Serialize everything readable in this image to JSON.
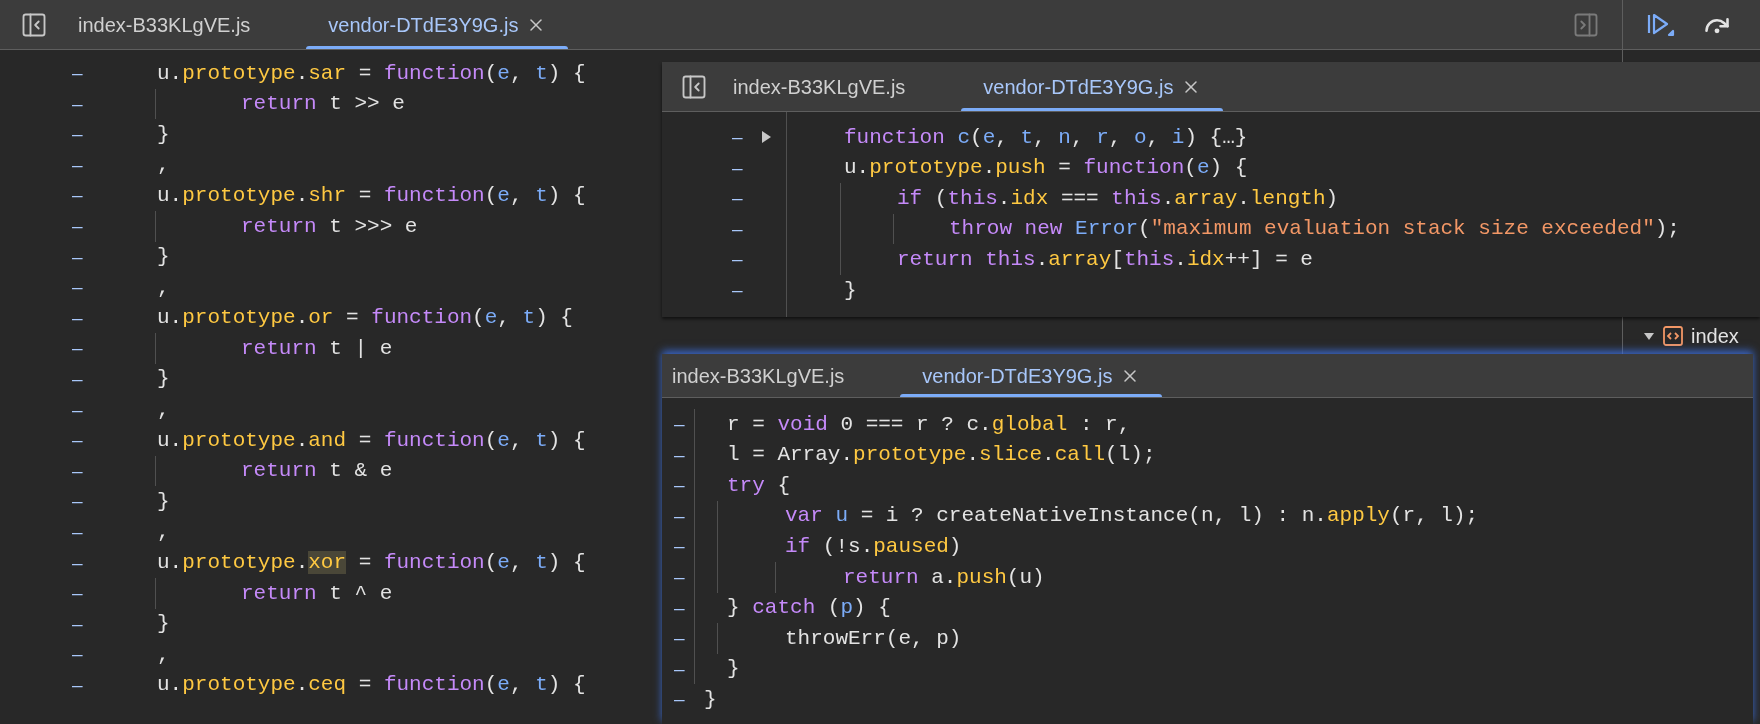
{
  "editor": {
    "tabs": [
      {
        "label": "index-B33KLgVE.js",
        "selected": false
      },
      {
        "label": "vendor-DTdE3Y9G.js",
        "selected": true
      }
    ],
    "lines": [
      {
        "mark": "–",
        "tokens": [
          {
            "kind": "plain",
            "text": "u."
          },
          {
            "kind": "prop",
            "text": "prototype"
          },
          {
            "kind": "plain",
            "text": "."
          },
          {
            "kind": "prop",
            "text": "sar"
          },
          {
            "kind": "plain",
            "text": " = "
          },
          {
            "kind": "kw",
            "text": "function"
          },
          {
            "kind": "plain",
            "text": "("
          },
          {
            "kind": "param",
            "text": "e"
          },
          {
            "kind": "plain",
            "text": ", "
          },
          {
            "kind": "param",
            "text": "t"
          },
          {
            "kind": "plain",
            "text": ") {"
          }
        ],
        "children": [
          {
            "mark": "–",
            "tokens": [
              {
                "kind": "kw",
                "text": "return"
              },
              {
                "kind": "plain",
                "text": " t >> e"
              }
            ]
          }
        ]
      },
      {
        "mark": "–",
        "tokens": [
          {
            "kind": "plain",
            "text": "}"
          }
        ]
      },
      {
        "mark": "–",
        "tokens": [
          {
            "kind": "plain",
            "text": ","
          }
        ]
      },
      {
        "mark": "–",
        "tokens": [
          {
            "kind": "plain",
            "text": "u."
          },
          {
            "kind": "prop",
            "text": "prototype"
          },
          {
            "kind": "plain",
            "text": "."
          },
          {
            "kind": "prop",
            "text": "shr"
          },
          {
            "kind": "plain",
            "text": " = "
          },
          {
            "kind": "kw",
            "text": "function"
          },
          {
            "kind": "plain",
            "text": "("
          },
          {
            "kind": "param",
            "text": "e"
          },
          {
            "kind": "plain",
            "text": ", "
          },
          {
            "kind": "param",
            "text": "t"
          },
          {
            "kind": "plain",
            "text": ") {"
          }
        ],
        "children": [
          {
            "mark": "–",
            "tokens": [
              {
                "kind": "kw",
                "text": "return"
              },
              {
                "kind": "plain",
                "text": " t >>> e"
              }
            ]
          }
        ]
      },
      {
        "mark": "–",
        "tokens": [
          {
            "kind": "plain",
            "text": "}"
          }
        ]
      },
      {
        "mark": "–",
        "tokens": [
          {
            "kind": "plain",
            "text": ","
          }
        ]
      },
      {
        "mark": "–",
        "tokens": [
          {
            "kind": "plain",
            "text": "u."
          },
          {
            "kind": "prop",
            "text": "prototype"
          },
          {
            "kind": "plain",
            "text": "."
          },
          {
            "kind": "prop",
            "text": "or"
          },
          {
            "kind": "plain",
            "text": " = "
          },
          {
            "kind": "kw",
            "text": "function"
          },
          {
            "kind": "plain",
            "text": "("
          },
          {
            "kind": "param",
            "text": "e"
          },
          {
            "kind": "plain",
            "text": ", "
          },
          {
            "kind": "param",
            "text": "t"
          },
          {
            "kind": "plain",
            "text": ") {"
          }
        ],
        "children": [
          {
            "mark": "–",
            "tokens": [
              {
                "kind": "kw",
                "text": "return"
              },
              {
                "kind": "plain",
                "text": " t | e"
              }
            ]
          }
        ]
      },
      {
        "mark": "–",
        "tokens": [
          {
            "kind": "plain",
            "text": "}"
          }
        ]
      },
      {
        "mark": "–",
        "tokens": [
          {
            "kind": "plain",
            "text": ","
          }
        ]
      },
      {
        "mark": "–",
        "tokens": [
          {
            "kind": "plain",
            "text": "u."
          },
          {
            "kind": "prop",
            "text": "prototype"
          },
          {
            "kind": "plain",
            "text": "."
          },
          {
            "kind": "prop",
            "text": "and"
          },
          {
            "kind": "plain",
            "text": " = "
          },
          {
            "kind": "kw",
            "text": "function"
          },
          {
            "kind": "plain",
            "text": "("
          },
          {
            "kind": "param",
            "text": "e"
          },
          {
            "kind": "plain",
            "text": ", "
          },
          {
            "kind": "param",
            "text": "t"
          },
          {
            "kind": "plain",
            "text": ") {"
          }
        ],
        "children": [
          {
            "mark": "–",
            "tokens": [
              {
                "kind": "kw",
                "text": "return"
              },
              {
                "kind": "plain",
                "text": " t & e"
              }
            ]
          }
        ]
      },
      {
        "mark": "–",
        "tokens": [
          {
            "kind": "plain",
            "text": "}"
          }
        ]
      },
      {
        "mark": "–",
        "tokens": [
          {
            "kind": "plain",
            "text": ","
          }
        ]
      },
      {
        "mark": "–",
        "tokens": [
          {
            "kind": "plain",
            "text": "u."
          },
          {
            "kind": "prop",
            "text": "prototype"
          },
          {
            "kind": "plain",
            "text": "."
          },
          {
            "kind": "match",
            "text": "xor"
          },
          {
            "kind": "plain",
            "text": " = "
          },
          {
            "kind": "kw",
            "text": "function"
          },
          {
            "kind": "plain",
            "text": "("
          },
          {
            "kind": "param",
            "text": "e"
          },
          {
            "kind": "plain",
            "text": ", "
          },
          {
            "kind": "param",
            "text": "t"
          },
          {
            "kind": "plain",
            "text": ") {"
          }
        ],
        "children": [
          {
            "mark": "–",
            "tokens": [
              {
                "kind": "kw",
                "text": "return"
              },
              {
                "kind": "plain",
                "text": " t ^ e"
              }
            ]
          }
        ]
      },
      {
        "mark": "–",
        "tokens": [
          {
            "kind": "plain",
            "text": "}"
          }
        ]
      },
      {
        "mark": "–",
        "tokens": [
          {
            "kind": "plain",
            "text": ","
          }
        ]
      },
      {
        "mark": "–",
        "tokens": [
          {
            "kind": "plain",
            "text": "u."
          },
          {
            "kind": "prop",
            "text": "prototype"
          },
          {
            "kind": "plain",
            "text": "."
          },
          {
            "kind": "prop",
            "text": "ceq"
          },
          {
            "kind": "plain",
            "text": " = "
          },
          {
            "kind": "kw",
            "text": "function"
          },
          {
            "kind": "plain",
            "text": "("
          },
          {
            "kind": "param",
            "text": "e"
          },
          {
            "kind": "plain",
            "text": ", "
          },
          {
            "kind": "param",
            "text": "t"
          },
          {
            "kind": "plain",
            "text": ") {"
          }
        ]
      }
    ]
  },
  "overlays": [
    {
      "tabs": [
        {
          "label": "index-B33KLgVE.js",
          "selected": false
        },
        {
          "label": "vendor-DTdE3Y9G.js",
          "selected": true
        }
      ],
      "lines": [
        {
          "mark": "–",
          "expanded": false,
          "tokens": [
            {
              "kind": "kw",
              "text": "function"
            },
            {
              "kind": "param",
              "text": " c"
            },
            {
              "kind": "plain",
              "text": "("
            },
            {
              "kind": "param",
              "text": "e"
            },
            {
              "kind": "plain",
              "text": ", "
            },
            {
              "kind": "param",
              "text": "t"
            },
            {
              "kind": "plain",
              "text": ", "
            },
            {
              "kind": "param",
              "text": "n"
            },
            {
              "kind": "plain",
              "text": ", "
            },
            {
              "kind": "param",
              "text": "r"
            },
            {
              "kind": "plain",
              "text": ", "
            },
            {
              "kind": "param",
              "text": "o"
            },
            {
              "kind": "plain",
              "text": ", "
            },
            {
              "kind": "param",
              "text": "i"
            },
            {
              "kind": "plain",
              "text": ") {…}"
            }
          ]
        },
        {
          "mark": "–",
          "tokens": [
            {
              "kind": "plain",
              "text": "u."
            },
            {
              "kind": "prop",
              "text": "prototype"
            },
            {
              "kind": "plain",
              "text": "."
            },
            {
              "kind": "prop",
              "text": "push"
            },
            {
              "kind": "plain",
              "text": " = "
            },
            {
              "kind": "kw",
              "text": "function"
            },
            {
              "kind": "plain",
              "text": "("
            },
            {
              "kind": "param",
              "text": "e"
            },
            {
              "kind": "plain",
              "text": ") {"
            }
          ],
          "children": [
            {
              "mark": "–",
              "tokens": [
                {
                  "kind": "kw",
                  "text": "if"
                },
                {
                  "kind": "plain",
                  "text": " ("
                },
                {
                  "kind": "kw",
                  "text": "this"
                },
                {
                  "kind": "plain",
                  "text": "."
                },
                {
                  "kind": "prop",
                  "text": "idx"
                },
                {
                  "kind": "plain",
                  "text": " === "
                },
                {
                  "kind": "kw",
                  "text": "this"
                },
                {
                  "kind": "plain",
                  "text": "."
                },
                {
                  "kind": "prop",
                  "text": "array"
                },
                {
                  "kind": "plain",
                  "text": "."
                },
                {
                  "kind": "prop",
                  "text": "length"
                },
                {
                  "kind": "plain",
                  "text": ")"
                }
              ],
              "children": [
                {
                  "mark": "–",
                  "tokens": [
                    {
                      "kind": "kw",
                      "text": "throw"
                    },
                    {
                      "kind": "kw",
                      "text": " new"
                    },
                    {
                      "kind": "param",
                      "text": " Error"
                    },
                    {
                      "kind": "plain",
                      "text": "("
                    },
                    {
                      "kind": "str",
                      "text": "\"maximum evaluation stack size exceeded\""
                    },
                    {
                      "kind": "plain",
                      "text": ");"
                    }
                  ]
                }
              ]
            },
            {
              "mark": "–",
              "tokens": [
                {
                  "kind": "kw",
                  "text": "return"
                },
                {
                  "kind": "kw",
                  "text": " this"
                },
                {
                  "kind": "plain",
                  "text": "."
                },
                {
                  "kind": "prop",
                  "text": "array"
                },
                {
                  "kind": "plain",
                  "text": "["
                },
                {
                  "kind": "kw",
                  "text": "this"
                },
                {
                  "kind": "plain",
                  "text": "."
                },
                {
                  "kind": "prop",
                  "text": "idx"
                },
                {
                  "kind": "plain",
                  "text": "++] = e"
                }
              ]
            }
          ]
        },
        {
          "mark": "–",
          "tokens": [
            {
              "kind": "plain",
              "text": "}"
            }
          ]
        }
      ]
    },
    {
      "tabs": [
        {
          "label": "index-B33KLgVE.js",
          "selected": false
        },
        {
          "label": "vendor-DTdE3Y9G.js",
          "selected": true
        }
      ],
      "lines": [
        {
          "children": [
            {
              "mark": "–",
              "tokens": [
                {
                  "kind": "plain",
                  "text": "r = "
                },
                {
                  "kind": "kw",
                  "text": "void"
                },
                {
                  "kind": "plain",
                  "text": " 0 === r ? c."
                },
                {
                  "kind": "prop",
                  "text": "global"
                },
                {
                  "kind": "plain",
                  "text": " : r,"
                }
              ]
            },
            {
              "mark": "–",
              "tokens": [
                {
                  "kind": "plain",
                  "text": "l = Array."
                },
                {
                  "kind": "prop",
                  "text": "prototype"
                },
                {
                  "kind": "plain",
                  "text": "."
                },
                {
                  "kind": "prop",
                  "text": "slice"
                },
                {
                  "kind": "plain",
                  "text": "."
                },
                {
                  "kind": "prop",
                  "text": "call"
                },
                {
                  "kind": "plain",
                  "text": "(l);"
                }
              ]
            },
            {
              "mark": "–",
              "tokens": [
                {
                  "kind": "kw",
                  "text": "try"
                },
                {
                  "kind": "plain",
                  "text": " {"
                }
              ],
              "children": [
                {
                  "mark": "–",
                  "tokens": [
                    {
                      "kind": "kw",
                      "text": "var"
                    },
                    {
                      "kind": "param",
                      "text": " u"
                    },
                    {
                      "kind": "plain",
                      "text": " = i ? createNativeInstance(n, l) : n."
                    },
                    {
                      "kind": "prop",
                      "text": "apply"
                    },
                    {
                      "kind": "plain",
                      "text": "(r, l);"
                    }
                  ]
                },
                {
                  "mark": "–",
                  "tokens": [
                    {
                      "kind": "kw",
                      "text": "if"
                    },
                    {
                      "kind": "plain",
                      "text": " (!s."
                    },
                    {
                      "kind": "prop",
                      "text": "paused"
                    },
                    {
                      "kind": "plain",
                      "text": ")"
                    }
                  ],
                  "children": [
                    {
                      "mark": "–",
                      "tokens": [
                        {
                          "kind": "kw",
                          "text": "return"
                        },
                        {
                          "kind": "plain",
                          "text": " a."
                        },
                        {
                          "kind": "prop",
                          "text": "push"
                        },
                        {
                          "kind": "plain",
                          "text": "(u)"
                        }
                      ]
                    }
                  ]
                }
              ]
            },
            {
              "mark": "–",
              "tokens": [
                {
                  "kind": "plain",
                  "text": "} "
                },
                {
                  "kind": "kw",
                  "text": "catch"
                },
                {
                  "kind": "plain",
                  "text": " ("
                },
                {
                  "kind": "param",
                  "text": "p"
                },
                {
                  "kind": "plain",
                  "text": ") {"
                }
              ],
              "children": [
                {
                  "mark": "–",
                  "tokens": [
                    {
                      "kind": "plain",
                      "text": "throwErr(e, p)"
                    }
                  ]
                }
              ]
            },
            {
              "mark": "–",
              "tokens": [
                {
                  "kind": "plain",
                  "text": "}"
                }
              ]
            }
          ]
        },
        {
          "mark": "–",
          "tokens": [
            {
              "kind": "plain",
              "text": "}"
            }
          ]
        }
      ]
    }
  ],
  "sidebar_tree": {
    "items": [
      {
        "label": "index",
        "expanded": true
      }
    ]
  }
}
